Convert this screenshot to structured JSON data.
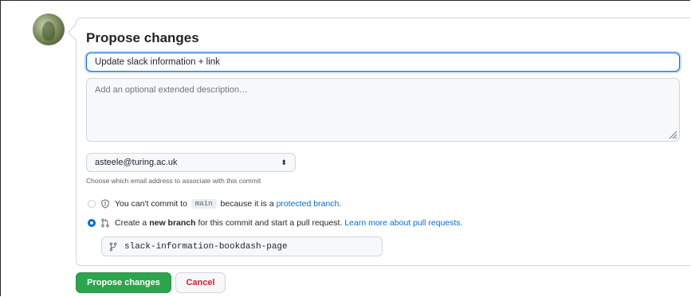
{
  "form": {
    "title": "Propose changes",
    "summary_value": "Update slack information + link",
    "description_placeholder": "Add an optional extended description…",
    "email": {
      "selected": "asteele@turing.ac.uk",
      "hint": "Choose which email address to associate with this commit"
    },
    "options": {
      "direct": {
        "prefix": "You can't commit to",
        "branch": "main",
        "middle": "because it is a",
        "link": "protected branch",
        "end": "."
      },
      "new_branch": {
        "prefix": "Create a",
        "bold": "new branch",
        "middle": "for this commit and start a pull request.",
        "link": "Learn more about pull requests."
      }
    },
    "branch_name": "slack-information-bookdash-page",
    "buttons": {
      "propose": "Propose changes",
      "cancel": "Cancel"
    }
  },
  "colors": {
    "accent": "#0969da",
    "primary_button": "#2da44e",
    "danger_text": "#cf222e"
  },
  "icons": [
    "avatar",
    "shield-icon",
    "pull-request-icon",
    "git-branch-icon",
    "resize-grip-icon",
    "select-arrows-icon"
  ]
}
